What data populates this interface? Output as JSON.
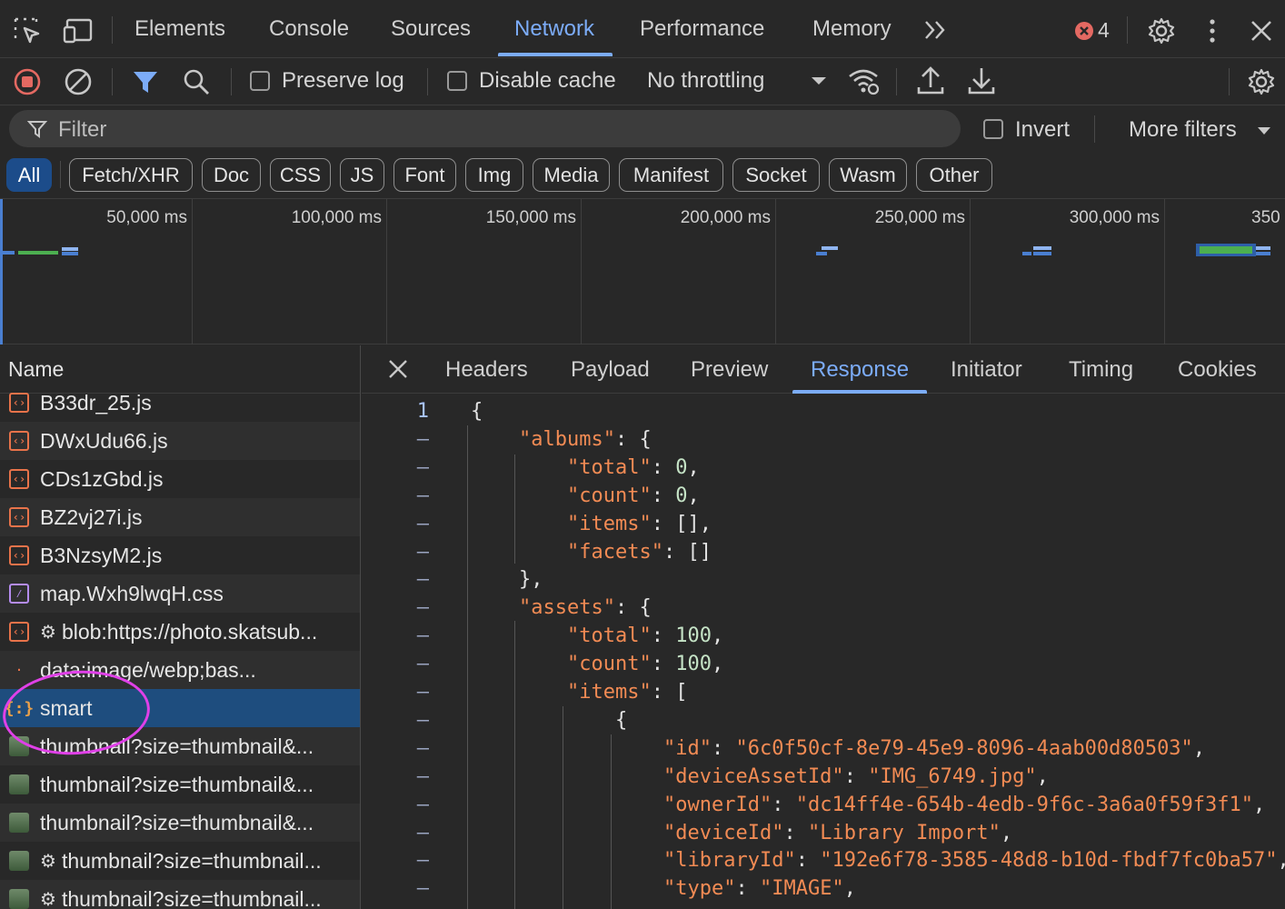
{
  "devtools": {
    "tabs": [
      "Elements",
      "Console",
      "Sources",
      "Network",
      "Performance",
      "Memory"
    ],
    "active_tab": "Network",
    "error_count": "4"
  },
  "toolbar": {
    "preserve_log": "Preserve log",
    "disable_cache": "Disable cache",
    "throttling": "No throttling"
  },
  "filter": {
    "placeholder": "Filter",
    "invert": "Invert",
    "more_filters": "More filters"
  },
  "type_filters": [
    "All",
    "Fetch/XHR",
    "Doc",
    "CSS",
    "JS",
    "Font",
    "Img",
    "Media",
    "Manifest",
    "Socket",
    "Wasm",
    "Other"
  ],
  "overview": {
    "ticks": [
      "50,000 ms",
      "100,000 ms",
      "150,000 ms",
      "200,000 ms",
      "250,000 ms",
      "300,000 ms",
      "350"
    ]
  },
  "requests": {
    "header": "Name",
    "items": [
      {
        "name": "B33dr_25.js",
        "icon": "script-icon"
      },
      {
        "name": "DWxUdu66.js",
        "icon": "script-icon"
      },
      {
        "name": "CDs1zGbd.js",
        "icon": "script-icon"
      },
      {
        "name": "BZ2vj27i.js",
        "icon": "script-icon"
      },
      {
        "name": "B3NzsyM2.js",
        "icon": "script-icon"
      },
      {
        "name": "map.Wxh9lwqH.css",
        "icon": "stylesheet-icon"
      },
      {
        "name": "blob:https://photo.skatsub...",
        "icon": "script-icon"
      },
      {
        "name": "data:image/webp;bas...",
        "icon": "blank-icon"
      },
      {
        "name": "smart",
        "icon": "json-icon",
        "selected": true
      },
      {
        "name": "thumbnail?size=thumbnail&...",
        "icon": "image-icon"
      },
      {
        "name": "thumbnail?size=thumbnail&...",
        "icon": "image-icon"
      },
      {
        "name": "thumbnail?size=thumbnail&...",
        "icon": "image-icon"
      },
      {
        "name": "thumbnail?size=thumbnail...",
        "icon": "image-icon"
      },
      {
        "name": "thumbnail?size=thumbnail...",
        "icon": "image-icon"
      }
    ]
  },
  "detail": {
    "tabs": [
      "Headers",
      "Payload",
      "Preview",
      "Response",
      "Initiator",
      "Timing",
      "Cookies"
    ],
    "active_tab": "Response"
  },
  "response": {
    "gutter_first": "1",
    "gutter_other": "–",
    "lines": [
      {
        "text": "{"
      },
      {
        "key": "\"albums\"",
        "rest": ": {"
      },
      {
        "key": "\"total\"",
        "num": "0",
        "rest": ","
      },
      {
        "key": "\"count\"",
        "num": "0",
        "rest": ","
      },
      {
        "key": "\"items\"",
        "rest": ": [],"
      },
      {
        "key": "\"facets\"",
        "rest": ": []"
      },
      {
        "text": "},"
      },
      {
        "key": "\"assets\"",
        "rest": ": {"
      },
      {
        "key": "\"total\"",
        "num": "100",
        "rest": ","
      },
      {
        "key": "\"count\"",
        "num": "100",
        "rest": ","
      },
      {
        "key": "\"items\"",
        "rest": ": ["
      },
      {
        "text": "{"
      },
      {
        "key": "\"id\"",
        "str": "\"6c0f50cf-8e79-45e9-8096-4aab00d80503\"",
        "rest": ","
      },
      {
        "key": "\"deviceAssetId\"",
        "str": "\"IMG_6749.jpg\"",
        "rest": ","
      },
      {
        "key": "\"ownerId\"",
        "str": "\"dc14ff4e-654b-4edb-9f6c-3a6a0f59f3f1\"",
        "rest": ","
      },
      {
        "key": "\"deviceId\"",
        "str": "\"Library Import\"",
        "rest": ","
      },
      {
        "key": "\"libraryId\"",
        "str": "\"192e6f78-3585-48d8-b10d-fbdf7fc0ba57\"",
        "rest": ","
      },
      {
        "key": "\"type\"",
        "str": "\"IMAGE\"",
        "rest": ","
      }
    ]
  }
}
